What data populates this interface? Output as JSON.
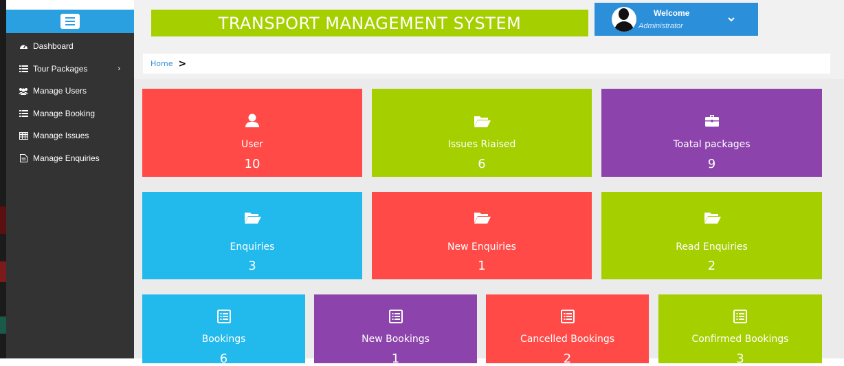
{
  "header": {
    "title": "TRANSPORT MANAGEMENT SYSTEM",
    "welcome_title": "Welcome",
    "welcome_sub": "Administrator"
  },
  "sidebar": {
    "items": [
      {
        "label": "Dashboard",
        "icon": "dashboard-icon"
      },
      {
        "label": "Tour Packages",
        "icon": "list-icon"
      },
      {
        "label": "Manage Users",
        "icon": "users-icon"
      },
      {
        "label": "Manage Booking",
        "icon": "list-icon"
      },
      {
        "label": "Manage Issues",
        "icon": "table-icon"
      },
      {
        "label": "Manage Enquiries",
        "icon": "file-icon"
      }
    ]
  },
  "breadcrumb": {
    "home": "Home",
    "separator": ">"
  },
  "cards": [
    {
      "label": "User",
      "value": "10",
      "icon": "user-icon",
      "color": "#ff4a47"
    },
    {
      "label": "Issues Riaised",
      "value": "6",
      "icon": "folder-open-icon",
      "color": "#a6cf00"
    },
    {
      "label": "Toatal packages",
      "value": "9",
      "icon": "briefcase-icon",
      "color": "#8c44ac"
    },
    {
      "label": "Enquiries",
      "value": "3",
      "icon": "folder-open-icon",
      "color": "#22b9ec"
    },
    {
      "label": "New Enquiries",
      "value": "1",
      "icon": "folder-open-icon",
      "color": "#ff4a47"
    },
    {
      "label": "Read Enquiries",
      "value": "2",
      "icon": "folder-open-icon",
      "color": "#a6cf00"
    },
    {
      "label": "Bookings",
      "value": "6",
      "icon": "list-alt-icon",
      "color": "#22b9ec"
    },
    {
      "label": "New Bookings",
      "value": "1",
      "icon": "list-alt-icon",
      "color": "#8c44ac"
    },
    {
      "label": "Cancelled Bookings",
      "value": "2",
      "icon": "list-alt-icon",
      "color": "#ff4a47"
    },
    {
      "label": "Confirmed Bookings",
      "value": "3",
      "icon": "list-alt-icon",
      "color": "#a6cf00"
    }
  ]
}
